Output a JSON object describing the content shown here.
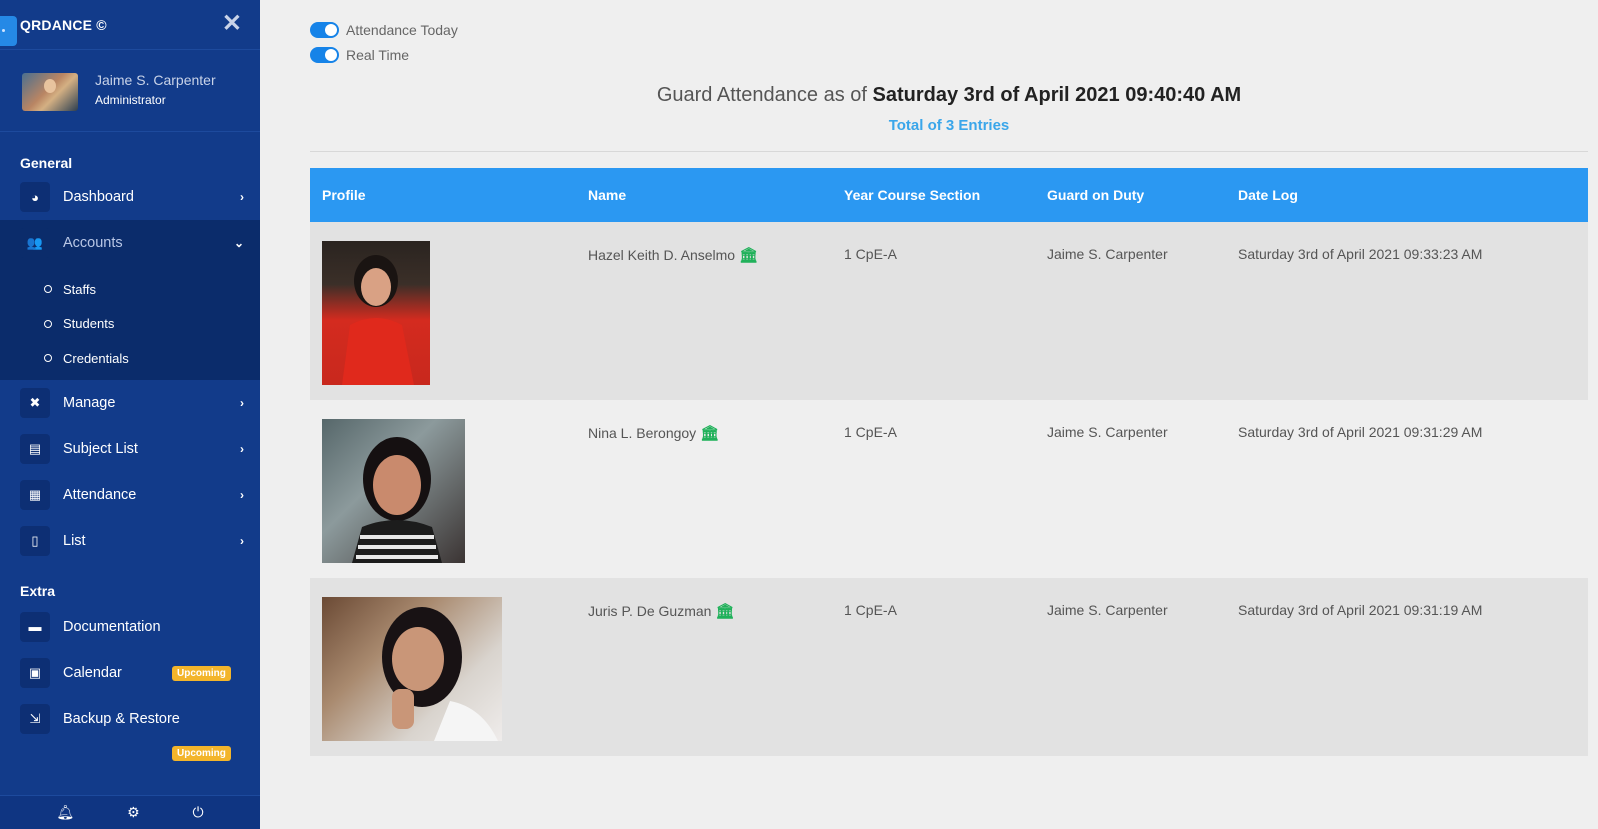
{
  "sidebar": {
    "brand": "QRDANCE ©",
    "close_icon": "close-icon",
    "user": {
      "name": "Jaime S. Carpenter",
      "role": "Administrator"
    },
    "sections": {
      "general": "General",
      "extra": "Extra"
    },
    "items": {
      "dashboard": "Dashboard",
      "accounts": "Accounts",
      "staffs": "Staffs",
      "students": "Students",
      "credentials": "Credentials",
      "manage": "Manage",
      "subject_list": "Subject List",
      "attendance": "Attendance",
      "list": "List",
      "documentation": "Documentation",
      "calendar": "Calendar",
      "backup_restore": "Backup & Restore"
    },
    "badges": {
      "calendar": "Upcoming",
      "backup_restore": "Upcoming"
    },
    "footer_icons": [
      "bell-icon",
      "gear-icon",
      "power-icon"
    ]
  },
  "toggles": {
    "attendance_today": "Attendance Today",
    "real_time": "Real Time"
  },
  "header": {
    "title_prefix": "Guard Attendance as of",
    "title_date": "Saturday 3rd of April 2021 09:40:40 AM",
    "total": "Total of 3 Entries"
  },
  "table": {
    "columns": [
      "Profile",
      "Name",
      "Year Course Section",
      "Guard on Duty",
      "Date Log"
    ],
    "rows": [
      {
        "name": "Hazel Keith D. Anselmo",
        "ycs": "1 CpE-A",
        "guard": "Jaime S. Carpenter",
        "date": "Saturday 3rd of April 2021 09:33:23 AM"
      },
      {
        "name": "Nina L. Berongoy",
        "ycs": "1 CpE-A",
        "guard": "Jaime S. Carpenter",
        "date": "Saturday 3rd of April 2021 09:31:29 AM"
      },
      {
        "name": "Juris P. De Guzman",
        "ycs": "1 CpE-A",
        "guard": "Jaime S. Carpenter",
        "date": "Saturday 3rd of April 2021 09:31:19 AM"
      }
    ]
  },
  "colors": {
    "sidebar": "#123b8a",
    "header": "#2b98f2",
    "accent": "#3aa6ea",
    "badge": "#f3b52b",
    "icon_green": "#20b15a"
  }
}
